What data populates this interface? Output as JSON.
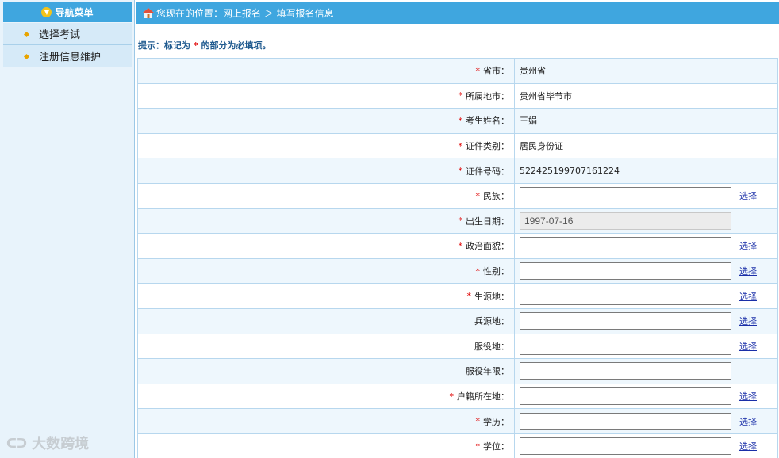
{
  "sidebar": {
    "header": "导航菜单",
    "items": [
      {
        "label": "选择考试"
      },
      {
        "label": "注册信息维护"
      }
    ],
    "watermark": "大数跨境"
  },
  "breadcrumb": {
    "text": "您现在的位置：网上报名 ＞ 填写报名信息"
  },
  "tip": {
    "prefix": "提示：标记为 ",
    "star": "*",
    "suffix": " 的部分为必填项。"
  },
  "form": {
    "required_mark": "*",
    "pick_label": "选择",
    "rows": [
      {
        "label": "省市：",
        "required": true,
        "type": "text",
        "value": "贵州省"
      },
      {
        "label": "所属地市：",
        "required": true,
        "type": "text",
        "value": "贵州省毕节市"
      },
      {
        "label": "考生姓名：",
        "required": true,
        "type": "text",
        "value": "王娟"
      },
      {
        "label": "证件类别：",
        "required": true,
        "type": "text",
        "value": "居民身份证"
      },
      {
        "label": "证件号码：",
        "required": true,
        "type": "text",
        "value": "522425199707161224"
      },
      {
        "label": "民族：",
        "required": true,
        "type": "input",
        "value": "",
        "pick": true
      },
      {
        "label": "出生日期：",
        "required": true,
        "type": "disabled",
        "value": "1997-07-16"
      },
      {
        "label": "政治面貌：",
        "required": true,
        "type": "input",
        "value": "",
        "pick": true
      },
      {
        "label": "性别：",
        "required": true,
        "type": "input",
        "value": "",
        "pick": true
      },
      {
        "label": "生源地：",
        "required": true,
        "type": "input",
        "value": "",
        "pick": true
      },
      {
        "label": "兵源地：",
        "required": false,
        "type": "input",
        "value": "",
        "pick": true
      },
      {
        "label": "服役地：",
        "required": false,
        "type": "input",
        "value": "",
        "pick": true
      },
      {
        "label": "服役年限：",
        "required": false,
        "type": "input",
        "value": "",
        "pick": false
      },
      {
        "label": "户籍所在地：",
        "required": true,
        "type": "input",
        "value": "",
        "pick": true
      },
      {
        "label": "学历：",
        "required": true,
        "type": "input",
        "value": "",
        "pick": true
      },
      {
        "label": "学位：",
        "required": true,
        "type": "input",
        "value": "",
        "pick": true
      }
    ]
  }
}
